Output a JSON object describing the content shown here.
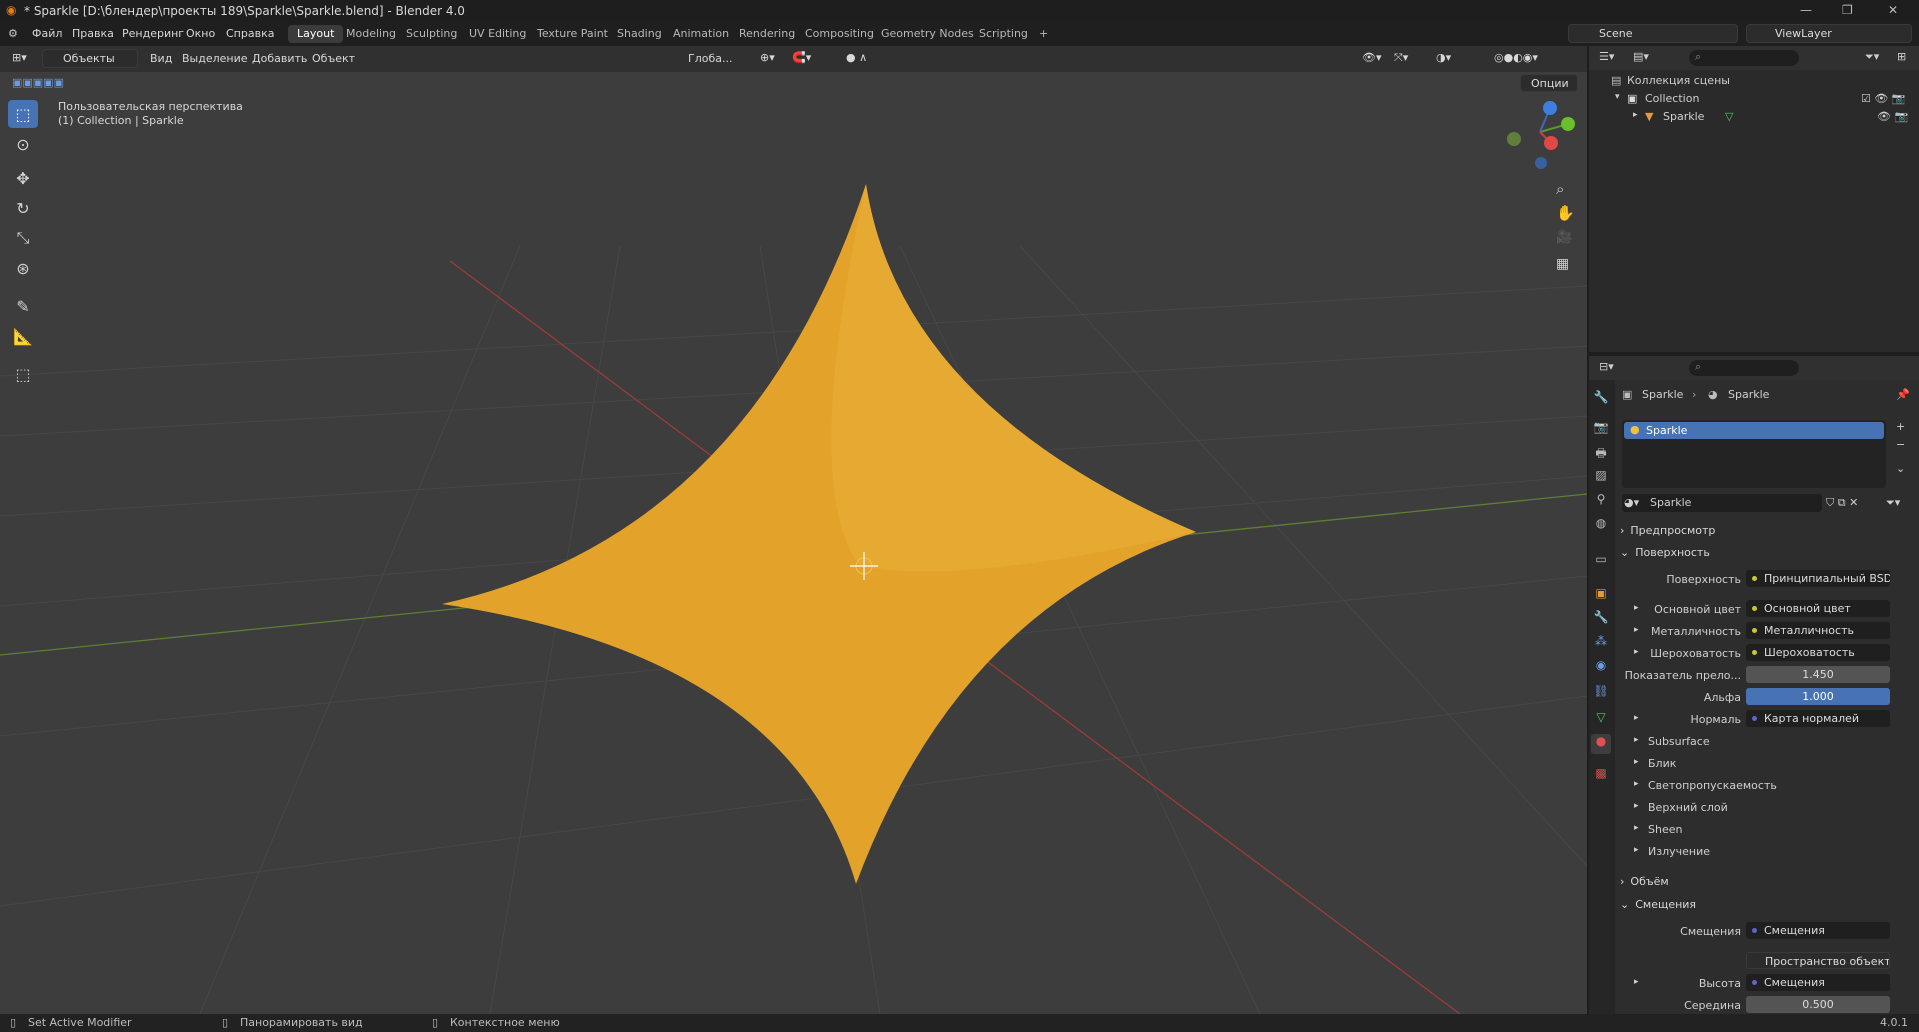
{
  "title": "* Sparkle [D:\\блендер\\проекты 189\\Sparkle\\Sparkle.blend] - Blender 4.0",
  "menu": [
    "Файл",
    "Правка",
    "Рендеринг",
    "Окно",
    "Справка"
  ],
  "workspaces": [
    "Layout",
    "Modeling",
    "Sculpting",
    "UV Editing",
    "Texture Paint",
    "Shading",
    "Animation",
    "Rendering",
    "Compositing",
    "Geometry Nodes",
    "Scripting"
  ],
  "active_workspace": "Layout",
  "scene": "Scene",
  "view_layer": "ViewLayer",
  "viewport": {
    "mode": "Объекты",
    "menu": [
      "Вид",
      "Выделение",
      "Добавить",
      "Объект"
    ],
    "transform": "Глоба...",
    "options": "Опции",
    "view_name": "Пользовательская перспектива",
    "collection_info": "(1) Collection | Sparkle"
  },
  "outliner": {
    "root": "Коллекция сцены",
    "collection": "Collection",
    "object": "Sparkle"
  },
  "properties": {
    "breadcrumb_object": "Sparkle",
    "breadcrumb_material": "Sparkle",
    "slot": "Sparkle",
    "material_name": "Sparkle",
    "sections": {
      "preview": "Предпросмотр",
      "surface": "Поверхность",
      "volume": "Объём",
      "displacement": "Смещения"
    },
    "surface_rows": [
      {
        "label": "Поверхность",
        "value": "Принципиальный BSDF",
        "kind": "link"
      },
      {
        "label": "Основной цвет",
        "value": "Основной цвет",
        "kind": "link"
      },
      {
        "label": "Металличность",
        "value": "Металличность",
        "kind": "link"
      },
      {
        "label": "Шероховатость",
        "value": "Шероховатость",
        "kind": "link"
      },
      {
        "label": "Показатель прело...",
        "value": "1.450",
        "kind": "num"
      },
      {
        "label": "Альфа",
        "value": "1.000",
        "kind": "blue"
      },
      {
        "label": "Нормаль",
        "value": "Карта нормалей",
        "kind": "link"
      }
    ],
    "subpanels": [
      "Subsurface",
      "Блик",
      "Светопропускаемость",
      "Верхний слой",
      "Sheen",
      "Излучение"
    ],
    "displacement_rows": [
      {
        "label": "Смещения",
        "value": "Смещения"
      },
      {
        "label": "",
        "value": "Пространство объекта"
      },
      {
        "label": "Высота",
        "value": "Смещения"
      },
      {
        "label": "Середина",
        "value": "0.500"
      }
    ]
  },
  "status": {
    "left": "Set Active Modifier",
    "mid": "Панорамировать вид",
    "right": "Контекстное меню",
    "version": "4.0.1"
  },
  "colors": {
    "star": "#e5a52a",
    "accent": "#4772b3",
    "viewport_bg": "#3d3d3d"
  }
}
